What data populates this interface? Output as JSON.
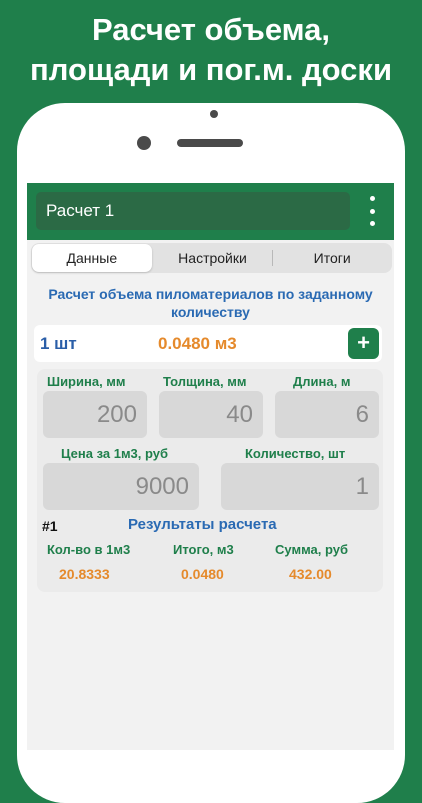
{
  "promo": {
    "line1": "Расчет объема,",
    "line2": "площади и пог.м. доски"
  },
  "header": {
    "title": "Расчет 1",
    "menu_icon": "kebab-vertical-icon"
  },
  "tabs": [
    {
      "label": "Данные",
      "active": true
    },
    {
      "label": "Настройки",
      "active": false
    },
    {
      "label": "Итоги",
      "active": false
    }
  ],
  "calc": {
    "heading": "Расчет объема пиломатериалов по заданному количеству",
    "count_label": "1 шт",
    "volume_label": "0.0480 м3",
    "add_icon": "+"
  },
  "inputs": {
    "width": {
      "label": "Ширина, мм",
      "value": "200"
    },
    "thickness": {
      "label": "Толщина, мм",
      "value": "40"
    },
    "length": {
      "label": "Длина, м",
      "value": "6"
    },
    "price": {
      "label": "Цена за 1м3, руб",
      "value": "9000"
    },
    "quantity": {
      "label": "Количество, шт",
      "value": "1"
    }
  },
  "results": {
    "number": "#1",
    "title": "Результаты расчета",
    "columns": [
      {
        "label": "Кол-во в 1м3",
        "value": "20.8333"
      },
      {
        "label": "Итого, м3",
        "value": "0.0480"
      },
      {
        "label": "Сумма, руб",
        "value": "432.00"
      }
    ]
  },
  "colors": {
    "brand_green": "#1f7f4b",
    "accent_orange": "#e58a2c",
    "accent_blue": "#2a6ab3"
  }
}
